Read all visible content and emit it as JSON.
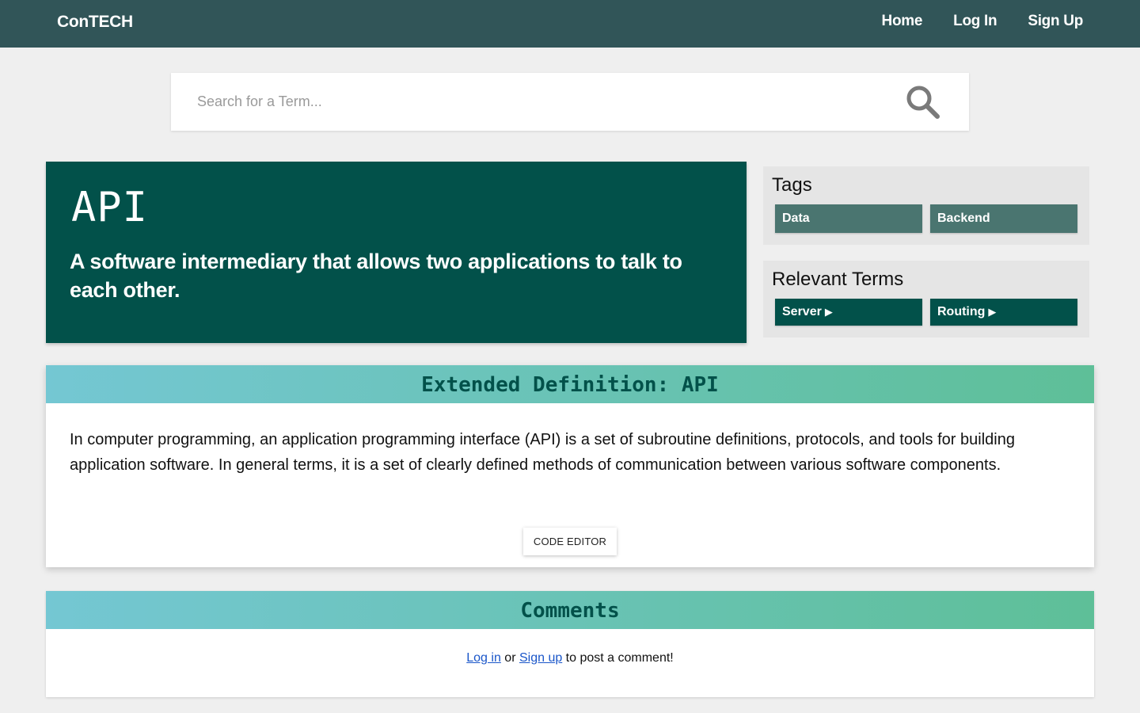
{
  "nav": {
    "brand": "ConTECH",
    "links": [
      {
        "label": "Home"
      },
      {
        "label": "Log In"
      },
      {
        "label": "Sign Up"
      }
    ]
  },
  "search": {
    "placeholder": "Search for a Term...",
    "value": "",
    "icon": "search-icon"
  },
  "term": {
    "title": "API",
    "summary": "A software intermediary that allows two applications to talk to each other."
  },
  "tags": {
    "heading": "Tags",
    "items": [
      {
        "label": "Data"
      },
      {
        "label": "Backend"
      }
    ]
  },
  "relevant": {
    "heading": "Relevant Terms",
    "items": [
      {
        "label": "Server",
        "icon": "play-arrow-icon"
      },
      {
        "label": "Routing",
        "icon": "play-arrow-icon"
      }
    ]
  },
  "extended": {
    "heading": "Extended Definition: API",
    "body": "In computer programming, an application programming interface (API) is a set of subroutine definitions, protocols, and tools for building application software. In general terms, it is a set of clearly defined methods of communication between various software components.",
    "button": "CODE EDITOR"
  },
  "comments": {
    "heading": "Comments",
    "login_link": "Log in",
    "or_text": " or ",
    "signup_link": "Sign up",
    "suffix": " to post a comment!"
  },
  "colors": {
    "navbar": "#315558",
    "term_card": "#02514a",
    "tag_chip": "#4a7570",
    "gradient_start": "#74c7d3",
    "gradient_end": "#5ebf98",
    "link": "#1a56c9"
  }
}
